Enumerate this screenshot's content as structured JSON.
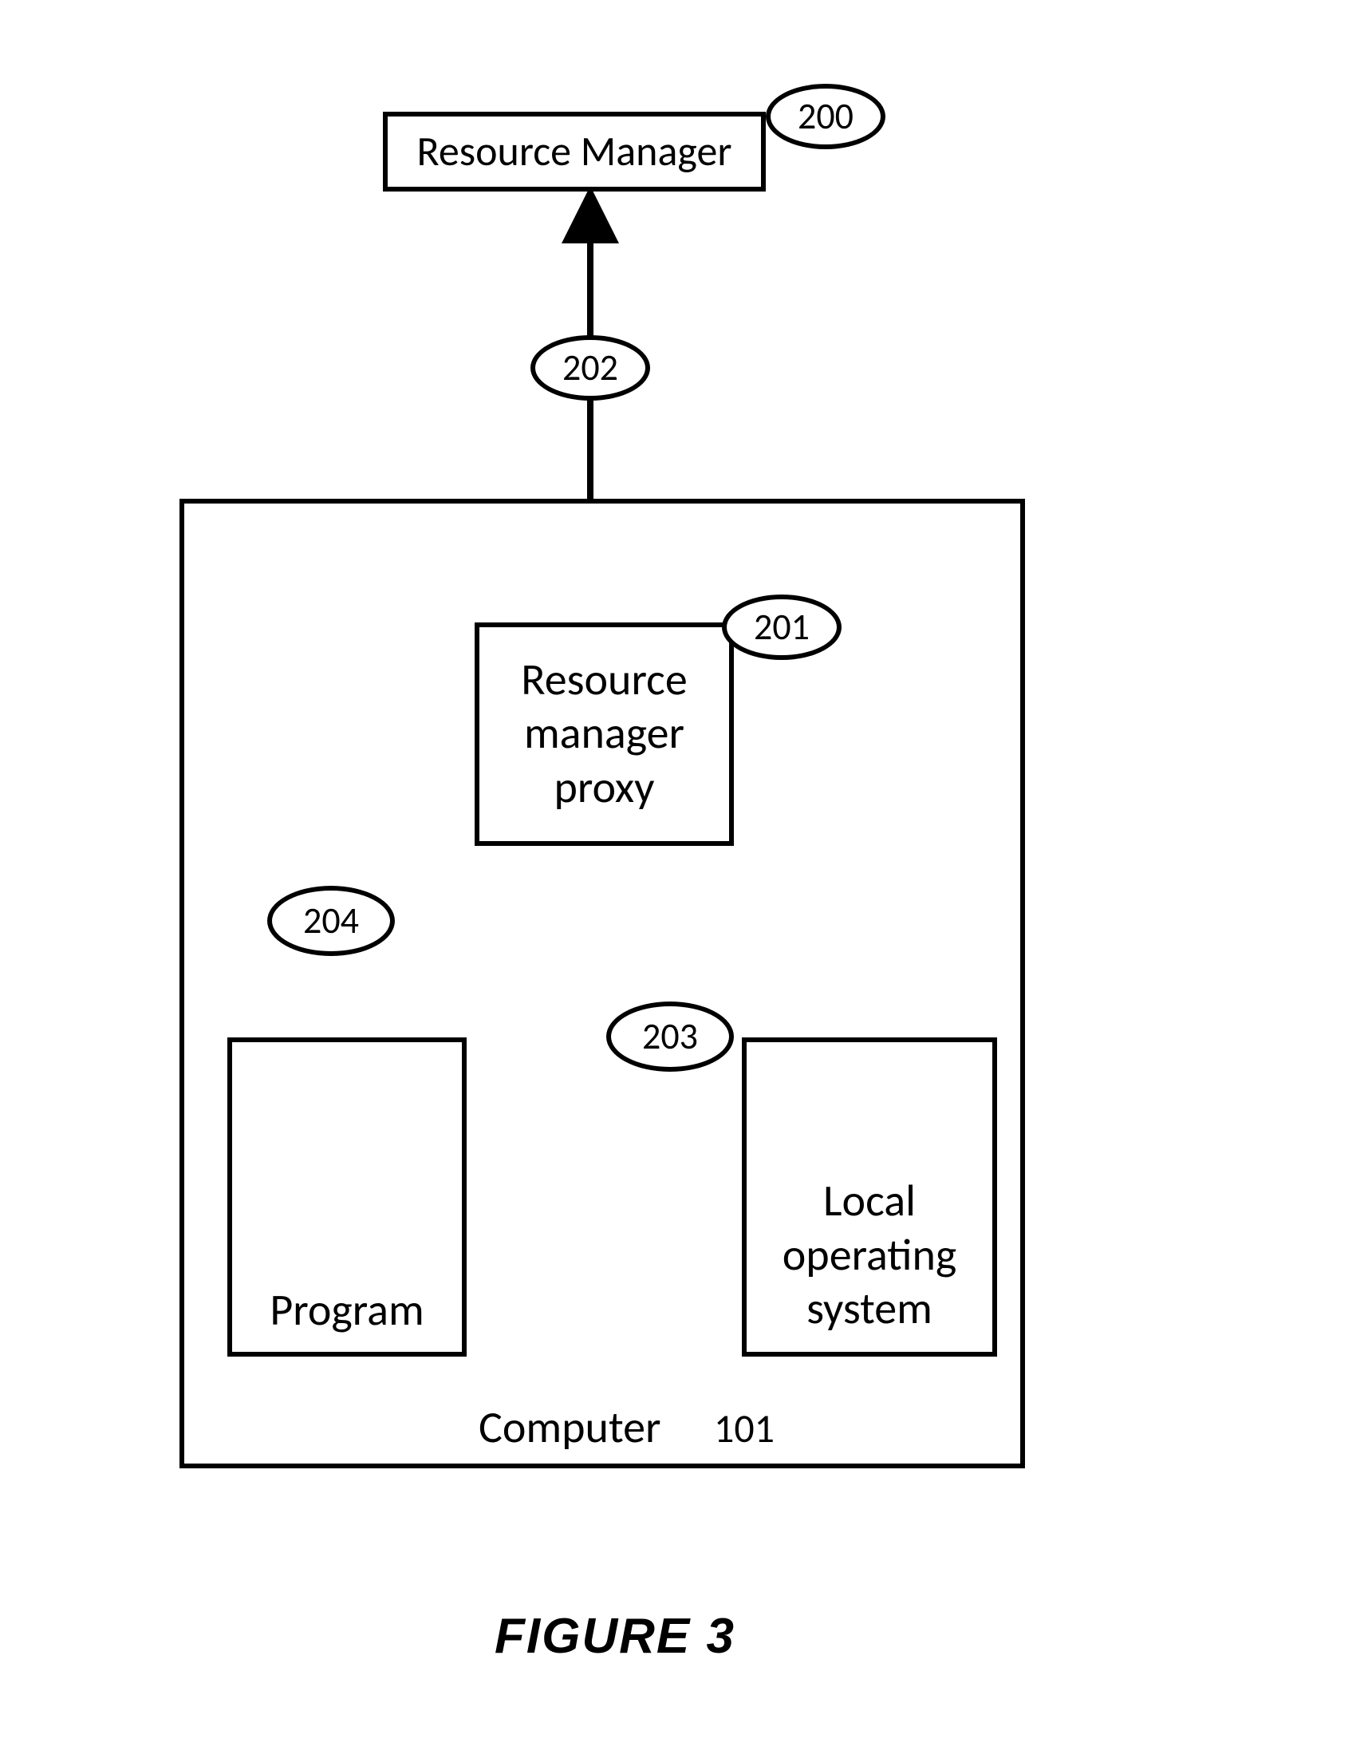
{
  "figure_caption": "FIGURE 3",
  "boxes": {
    "resource_manager": "Resource Manager",
    "resource_manager_proxy_l1": "Resource",
    "resource_manager_proxy_l2": "manager",
    "resource_manager_proxy_l3": "proxy",
    "program": "Program",
    "local_os_l1": "Local",
    "local_os_l2": "operating",
    "local_os_l3": "system",
    "computer_label": "Computer",
    "computer_ref": "101"
  },
  "refs": {
    "resource_manager": "200",
    "resource_manager_proxy": "201",
    "link_rm_proxy": "202",
    "link_proxy_os": "203",
    "link_program_proxy": "204"
  }
}
